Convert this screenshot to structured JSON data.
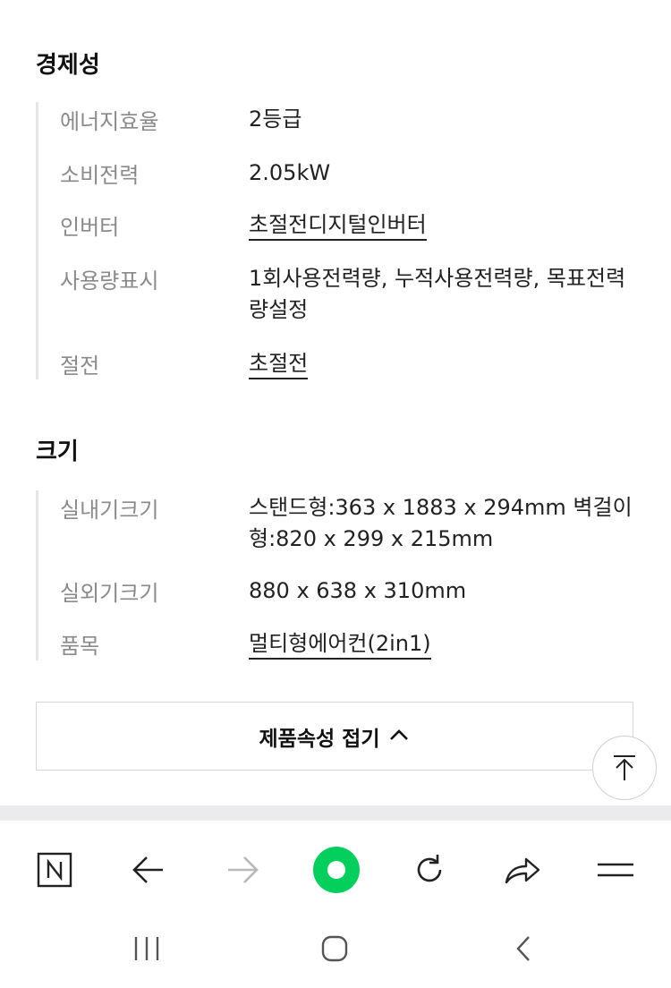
{
  "economy": {
    "title": "경제성",
    "rows": [
      {
        "label": "에너지효율",
        "value": "2등급"
      },
      {
        "label": "소비전력",
        "value": "2.05kW"
      },
      {
        "label": "인버터",
        "value": "초절전디지털인버터"
      },
      {
        "label": "사용량표시",
        "value": "1회사용전력량, 누적사용전력량, 목표전력량설정"
      },
      {
        "label": "절전",
        "value": "초절전"
      }
    ]
  },
  "size": {
    "title": "크기",
    "rows": [
      {
        "label": "실내기크기",
        "value": "스탠드형:363 x 1883 x 294mm 벽걸이형:820 x 299 x 215mm"
      },
      {
        "label": "실외기크기",
        "value": "880 x 638 x 310mm"
      },
      {
        "label": "품목",
        "value": "멀티형에어컨(2in1)"
      }
    ]
  },
  "collapse_button": {
    "label": "제품속성 접기"
  },
  "icons": {
    "brand": "naver-n-icon",
    "back": "back-arrow-icon",
    "forward": "forward-arrow-icon",
    "home": "green-circle-icon",
    "reload": "reload-icon",
    "share": "share-icon",
    "menu": "menu-icon",
    "scroll_top": "scroll-top-icon",
    "recent_apps": "recent-apps-icon",
    "system_home": "system-home-icon",
    "system_back": "system-back-icon"
  },
  "colors": {
    "accent_green": "#03cf5d",
    "label_gray": "#8a8a8a",
    "text": "#222222"
  }
}
